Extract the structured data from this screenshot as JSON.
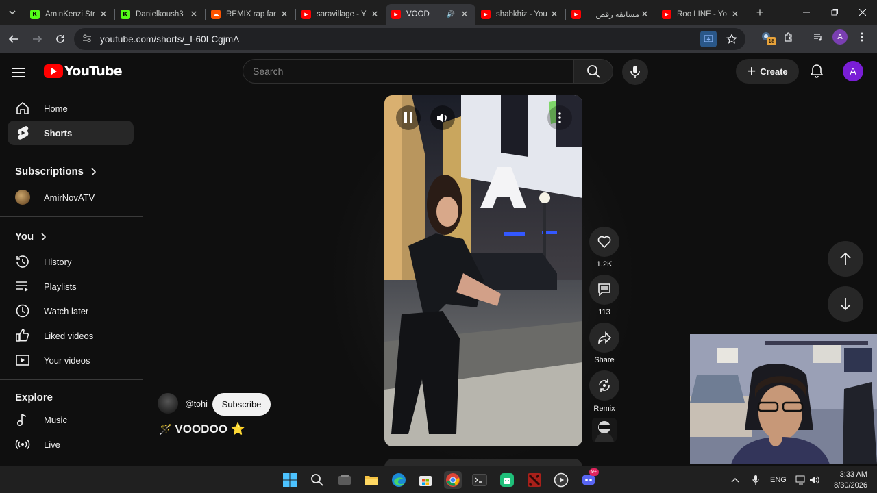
{
  "browser": {
    "tabs": [
      {
        "title": "AminKenzi Str",
        "favicon": "kick",
        "color": "#53fc18"
      },
      {
        "title": "Danielkoush3",
        "favicon": "kick",
        "color": "#53fc18"
      },
      {
        "title": "REMIX rap far",
        "favicon": "soundcloud",
        "color": "#ff5500"
      },
      {
        "title": "saravillage - Y",
        "favicon": "youtube",
        "color": "#ff0000"
      },
      {
        "title": "VOOD",
        "favicon": "youtube",
        "color": "#ff0000",
        "active": true
      },
      {
        "title": "shabkhiz - You",
        "favicon": "youtube",
        "color": "#ff0000"
      },
      {
        "title": "مسابقه رقص",
        "favicon": "youtube",
        "color": "#ff0000"
      },
      {
        "title": "Roo LINE - Yo",
        "favicon": "youtube",
        "color": "#ff0000"
      }
    ],
    "url": "youtube.com/shorts/_I-60LCgjmA",
    "extension_badge": "18",
    "profile_initial": "A"
  },
  "youtube": {
    "logo_text": "YouTube",
    "search_placeholder": "Search",
    "create_label": "Create",
    "avatar_initial": "A",
    "sidebar": {
      "main": [
        {
          "label": "Home",
          "icon": "home-icon"
        },
        {
          "label": "Shorts",
          "icon": "shorts-icon",
          "active": true
        }
      ],
      "subscriptions_heading": "Subscriptions",
      "subscriptions": [
        {
          "label": "AmirNovATV"
        }
      ],
      "you_heading": "You",
      "you_items": [
        {
          "label": "History",
          "icon": "history-icon"
        },
        {
          "label": "Playlists",
          "icon": "playlists-icon"
        },
        {
          "label": "Watch later",
          "icon": "watch-later-icon"
        },
        {
          "label": "Liked videos",
          "icon": "like-icon"
        },
        {
          "label": "Your videos",
          "icon": "your-videos-icon"
        }
      ],
      "explore_heading": "Explore",
      "explore_items": [
        {
          "label": "Music",
          "icon": "music-icon"
        },
        {
          "label": "Live",
          "icon": "live-icon"
        }
      ]
    },
    "short": {
      "channel_handle": "@tohi",
      "subscribe_label": "Subscribe",
      "title": "VOODOO",
      "likes": "1.2K",
      "comments": "113",
      "share_label": "Share",
      "remix_label": "Remix",
      "billboard_letter": "A"
    }
  },
  "taskbar": {
    "language": "ENG",
    "time": "3:33 AM",
    "date": "8/30/2026",
    "discord_badge": "9+"
  }
}
